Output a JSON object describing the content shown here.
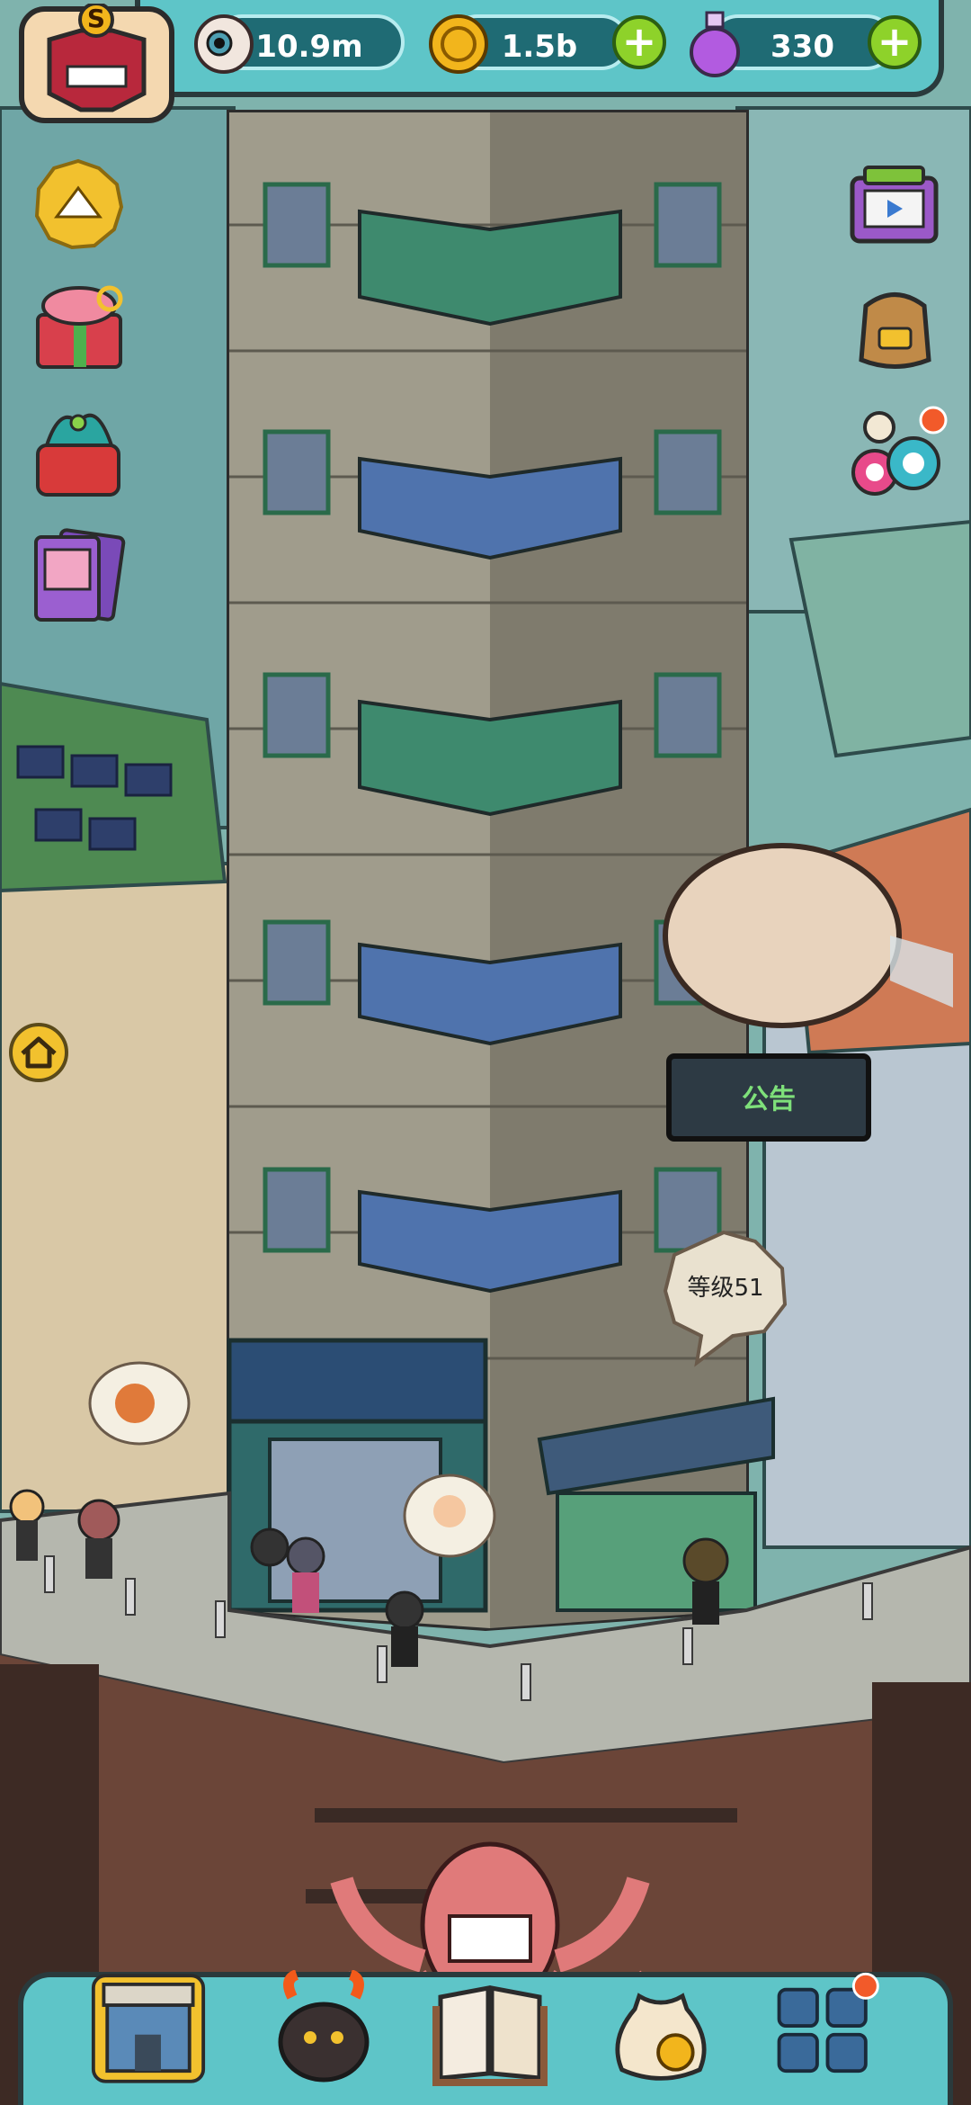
{
  "hud": {
    "eyes": {
      "value": "10.9m",
      "icon": "eyeball-icon"
    },
    "coins": {
      "value": "1.5b",
      "icon": "coin-icon"
    },
    "potions": {
      "value": "330",
      "icon": "potion-icon"
    },
    "plus_label": "+",
    "rank_badge": "S"
  },
  "scene": {
    "notice_sign": "公告",
    "level_bubble": "等级51"
  },
  "left_menu": [
    "up-arrow-icon",
    "gift-box-icon",
    "fruit-basket-icon",
    "cards-icon",
    "home-icon"
  ],
  "right_menu": [
    "tv-icon",
    "backpack-icon",
    "monster-eyes-icon"
  ],
  "bottom_tabs": [
    "building-tab-icon",
    "monster-tab-icon",
    "book-tab-icon",
    "money-bag-tab-icon",
    "grid-tab-icon"
  ],
  "colors": {
    "hud_bg": "#5ec5c8",
    "pill_bg": "#1f6b74",
    "plus_green": "#8ed22a",
    "sign_text": "#7ee07a"
  }
}
